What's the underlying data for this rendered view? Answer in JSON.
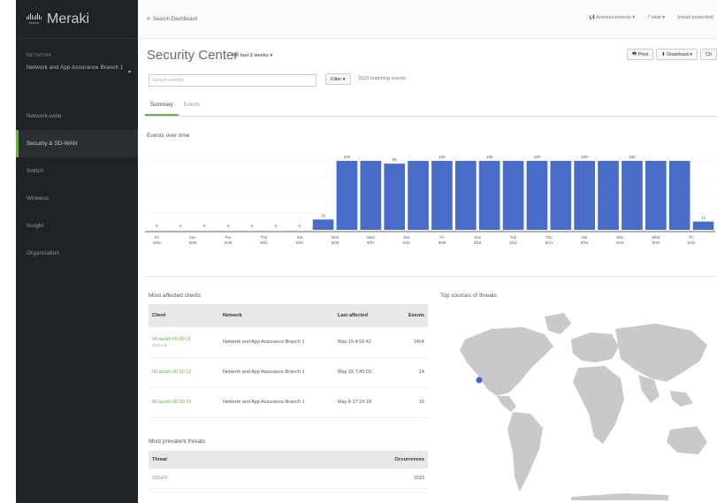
{
  "sidebar": {
    "logo_wordmark": "cisco",
    "logo_text": "Meraki",
    "network_label": "NETWORK",
    "network_name": "Network and App Assurance Branch 1",
    "items": [
      {
        "label": "Network-wide"
      },
      {
        "label": "Security & SD-WAN",
        "active": true
      },
      {
        "label": "Switch"
      },
      {
        "label": "Wireless"
      },
      {
        "label": "Insight"
      },
      {
        "label": "Organization"
      }
    ]
  },
  "topbar": {
    "search_label": "Search Dashboard",
    "announcements": "Announcements",
    "help": "Help",
    "user_email": "[email protected]"
  },
  "header": {
    "title": "Security Center",
    "timeframe": "for last 2 weeks",
    "print": "Print",
    "download": "Download",
    "extra": "Ch"
  },
  "filters": {
    "search_placeholder": "Search events",
    "filter_label": "Filter",
    "match_text": "1523 matching events"
  },
  "tabs": [
    {
      "label": "Summary",
      "active": true
    },
    {
      "label": "Events"
    }
  ],
  "events_over_time": {
    "title": "Events over time"
  },
  "chart_data": {
    "type": "bar",
    "title": "Events over time",
    "categories": [
      "Fri 5/26",
      "Sun 5/28",
      "Tue 5/30",
      "Thu 6/01",
      "Sat 6/03",
      "Mon 6/05",
      "Wed 6/07",
      "Sat 6/10",
      "Fri 5/08",
      "Sun 5/10",
      "Tue 5/12",
      "Thu 5/14",
      "Sat 5/16",
      "Mon 5/18",
      "Wed 5/20",
      "Fri 5/22"
    ],
    "values": [
      0,
      0,
      0,
      0,
      0,
      0,
      0,
      15,
      100,
      100,
      96,
      100,
      100,
      100,
      100,
      100,
      100,
      100,
      100,
      100,
      100,
      100,
      100,
      12
    ],
    "labels": [
      "0",
      "0",
      "0",
      "0",
      "0",
      "0",
      "0",
      "15",
      "100",
      "",
      "96",
      "",
      "100",
      "",
      "100",
      "",
      "100",
      "",
      "100",
      "",
      "100",
      "",
      "",
      "12"
    ],
    "ylim": [
      0,
      100
    ]
  },
  "clients": {
    "title": "Most affected clients",
    "columns": [
      "Client",
      "Network",
      "Last affected",
      "Events"
    ],
    "rows": [
      {
        "client": "00:aa:bb:00:00:11",
        "client_sub": "10.0.1.5",
        "network": "Network and App Assurance Branch 1",
        "last": "May 15 4:55:42",
        "events": "1404"
      },
      {
        "client": "00:aa:bb:00:00:12",
        "client_sub": "",
        "network": "Network and App Assurance Branch 1",
        "last": "May 15 7:40:03",
        "events": "14"
      },
      {
        "client": "00:aa:bb:00:00:13",
        "client_sub": "",
        "network": "Network and App Assurance Branch 1",
        "last": "May 8 17:24:18",
        "events": "15"
      }
    ]
  },
  "threats": {
    "title": "Most prevalent threats",
    "columns": [
      "Threat",
      "Occurrences"
    ],
    "rows": [
      {
        "threat": "SIGHS",
        "count": "1523"
      }
    ]
  },
  "sources": {
    "title": "Top sources of threats"
  },
  "colors": {
    "bar": "#4a6cc9",
    "accent": "#67b346",
    "sidebar": "#1f2326"
  }
}
